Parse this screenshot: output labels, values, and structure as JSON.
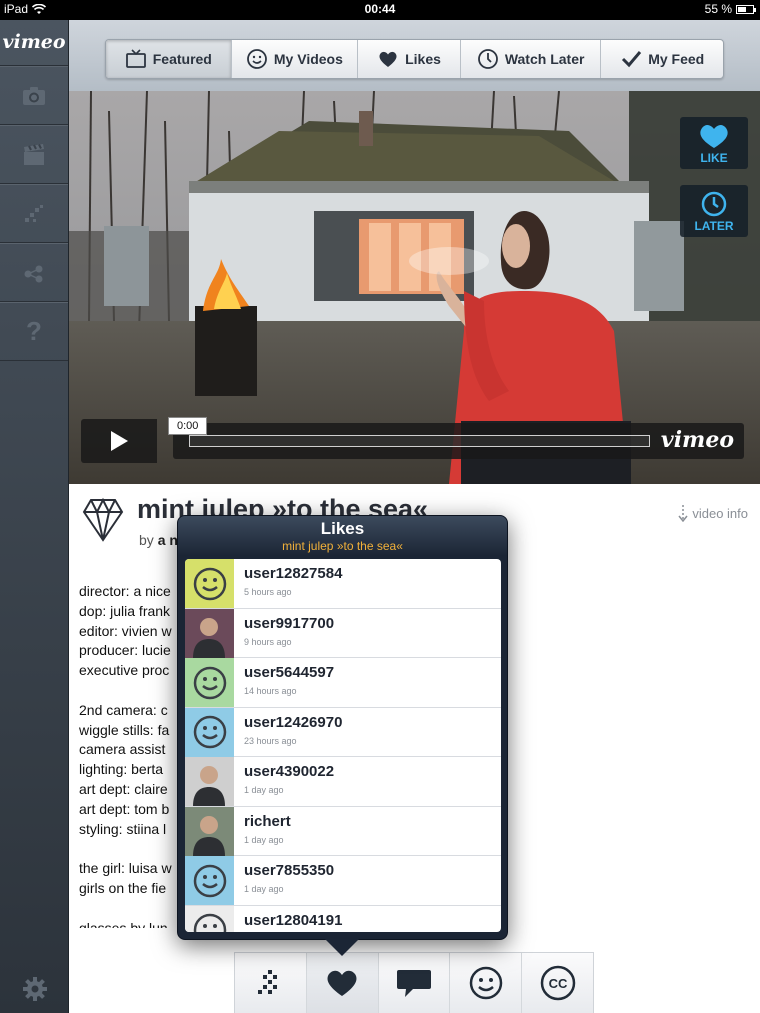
{
  "status_bar": {
    "device": "iPad",
    "time": "00:44",
    "battery": "55 %",
    "battery_level": 0.55
  },
  "sidebar": {
    "logo": "vimeo",
    "items": [
      {
        "icon": "camera-icon"
      },
      {
        "icon": "clapperboard-icon"
      },
      {
        "icon": "channels-icon"
      },
      {
        "icon": "groups-icon"
      },
      {
        "icon": "help-icon",
        "label": "?"
      }
    ],
    "settings_icon": "gear-icon"
  },
  "tabs": [
    {
      "label": "Featured",
      "icon": "tv-icon",
      "active": true
    },
    {
      "label": "My Videos",
      "icon": "smiley-icon",
      "active": false
    },
    {
      "label": "Likes",
      "icon": "heart-icon",
      "active": false
    },
    {
      "label": "Watch Later",
      "icon": "clock-icon",
      "active": false
    },
    {
      "label": "My Feed",
      "icon": "checkmark-icon",
      "active": false
    }
  ],
  "player": {
    "like_label": "LIKE",
    "later_label": "LATER",
    "time": "0:00",
    "logo": "vimeo",
    "progress": 0
  },
  "video": {
    "title": "mint julep »to the sea«",
    "by_prefix": "by",
    "author_visible": "a nice",
    "video_info_label": "video info",
    "credits": [
      "director: a nice",
      "dop: julia frank",
      "editor: vivien w",
      "producer: lucie",
      "executive proc",
      "",
      "2nd camera: c",
      "wiggle stills: fa",
      "camera assist",
      "lighting: berta",
      "art dept: claire",
      "art dept: tom b",
      "styling: stiina l",
      "",
      "the girl: luisa w",
      "girls on the fie",
      "",
      "glasses by lun"
    ]
  },
  "likes_popover": {
    "title": "Likes",
    "subtitle": "mint julep »to the sea«",
    "users": [
      {
        "name": "user12827584",
        "time": "5 hours ago",
        "avatar": "default",
        "color": "#d6e06a"
      },
      {
        "name": "user9917700",
        "time": "9 hours ago",
        "avatar": "photo",
        "color": "#6b4a5a"
      },
      {
        "name": "user5644597",
        "time": "14 hours ago",
        "avatar": "default",
        "color": "#a9d9a0"
      },
      {
        "name": "user12426970",
        "time": "23 hours ago",
        "avatar": "default",
        "color": "#8fcbe6"
      },
      {
        "name": "user4390022",
        "time": "1 day ago",
        "avatar": "photo",
        "color": "#cfcfcf"
      },
      {
        "name": "richert",
        "time": "1 day ago",
        "avatar": "photo",
        "color": "#7c8a78"
      },
      {
        "name": "user7855350",
        "time": "1 day ago",
        "avatar": "default",
        "color": "#8fcbe6"
      },
      {
        "name": "user12804191",
        "time": "",
        "avatar": "default",
        "color": "#ececec"
      }
    ]
  },
  "action_bar": [
    {
      "icon": "share-icon"
    },
    {
      "icon": "heart-icon",
      "active": true
    },
    {
      "icon": "comment-icon"
    },
    {
      "icon": "smiley-icon"
    },
    {
      "icon": "cc-icon"
    }
  ]
}
